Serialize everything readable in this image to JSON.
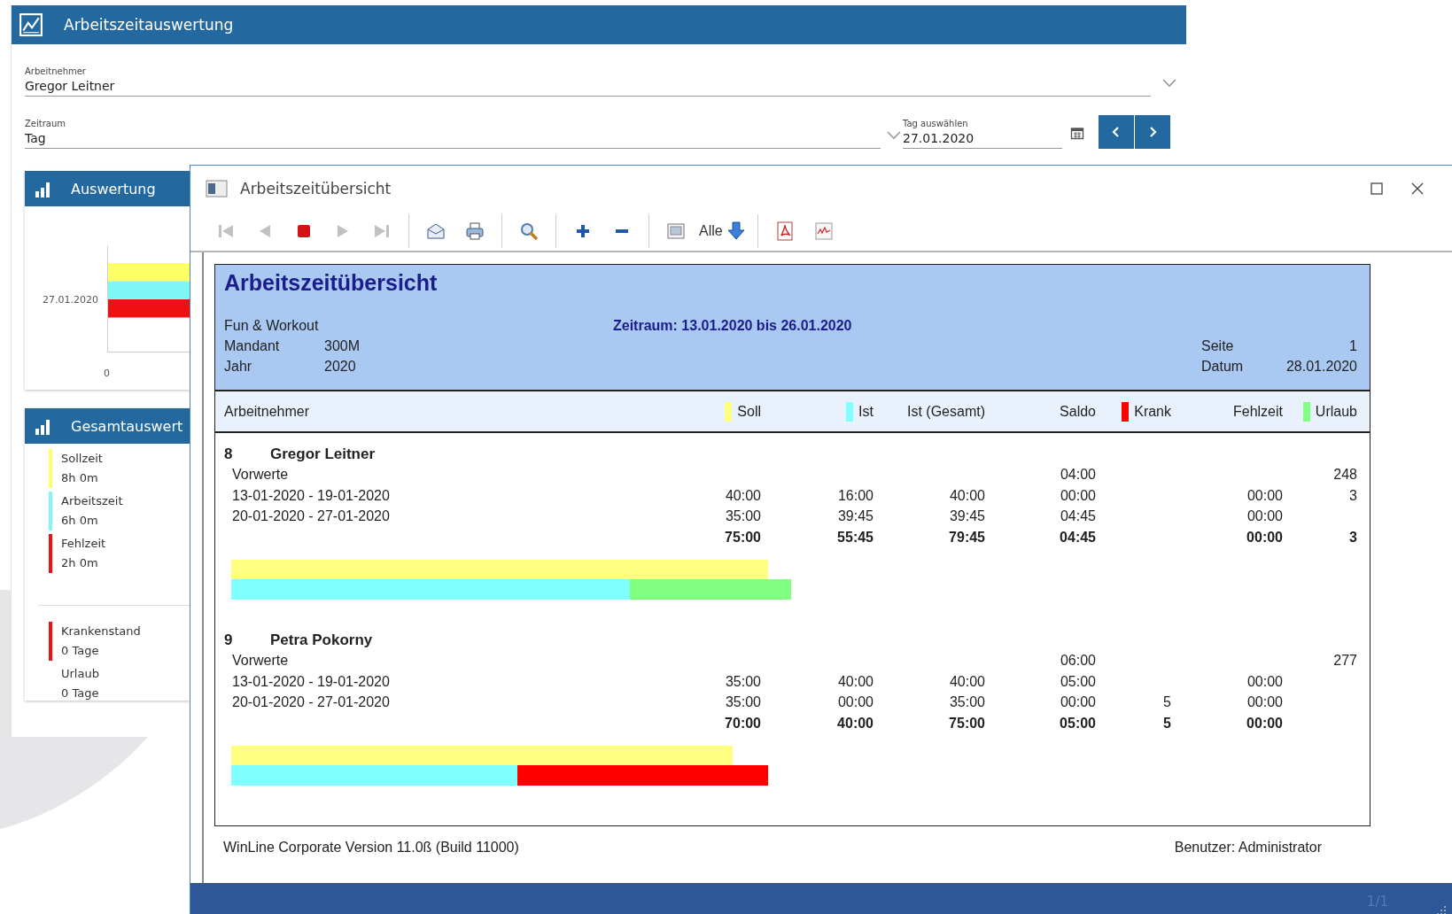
{
  "app": {
    "title": "Arbeitszeitauswertung",
    "employee_field": {
      "label": "Arbeitnehmer",
      "value": "Gregor Leitner"
    },
    "period_field": {
      "label": "Zeitraum",
      "value": "Tag"
    },
    "date_field": {
      "label": "Tag auswählen",
      "value": "27.01.2020"
    }
  },
  "auswertung": {
    "title": "Auswertung",
    "category": "27.01.2020",
    "x_tick": "0"
  },
  "gesamtauswertung": {
    "title": "Gesamtauswert",
    "groups": [
      [
        {
          "label": "Sollzeit",
          "value": "8h 0m",
          "color": "#ffff66"
        },
        {
          "label": "Arbeitszeit",
          "value": "6h 0m",
          "color": "#7ff7f7"
        },
        {
          "label": "Fehlzeit",
          "value": "2h 0m",
          "color": "#ee1111"
        }
      ],
      [
        {
          "label": "Krankenstand",
          "value": "0 Tage",
          "color": "#ee1111"
        },
        {
          "label": "Urlaub",
          "value": "0 Tage"
        }
      ]
    ]
  },
  "report_window": {
    "title": "Arbeitszeitübersicht",
    "toolbar": [
      {
        "kind": "first",
        "disabled": true
      },
      {
        "kind": "prev",
        "disabled": true
      },
      {
        "kind": "stop",
        "disabled": false
      },
      {
        "kind": "next",
        "disabled": true
      },
      {
        "kind": "last",
        "disabled": true
      },
      {
        "kind": "separator"
      },
      {
        "kind": "mail",
        "disabled": false
      },
      {
        "kind": "print",
        "disabled": false
      },
      {
        "kind": "separator"
      },
      {
        "kind": "zoom",
        "disabled": false
      },
      {
        "kind": "separator"
      },
      {
        "kind": "plus",
        "disabled": false
      },
      {
        "kind": "minus",
        "disabled": false
      },
      {
        "kind": "separator"
      },
      {
        "kind": "image",
        "disabled": false
      },
      {
        "kind": "filter",
        "label": "Alle",
        "disabled": false
      },
      {
        "kind": "separator"
      },
      {
        "kind": "pdf",
        "disabled": false
      },
      {
        "kind": "chart",
        "disabled": false
      }
    ],
    "report": {
      "title": "Arbeitszeitübersicht",
      "company": "Fun & Workout",
      "meta": [
        {
          "label": "Mandant",
          "value": "300M"
        },
        {
          "label": "Jahr",
          "value": "2020"
        }
      ],
      "period": "Zeitraum: 13.01.2020 bis 26.01.2020",
      "page_meta": [
        {
          "label": "Seite",
          "value": "1"
        },
        {
          "label": "Datum",
          "value": "28.01.2020"
        }
      ],
      "first_column": "Arbeitnehmer",
      "columns": [
        {
          "label": "Soll",
          "color": "#ffff80"
        },
        {
          "label": "Ist",
          "color": "#80ffff"
        },
        {
          "label": "Ist (Gesamt)"
        },
        {
          "label": "Saldo"
        },
        {
          "label": "Krank",
          "color": "#ff0000"
        },
        {
          "label": "Fehlzeit"
        },
        {
          "label": "Urlaub",
          "color": "#80ff80"
        }
      ],
      "employees": [
        {
          "number": "8",
          "name": "Gregor Leitner",
          "rows": [
            {
              "kind": "normal",
              "label": "Vorwerte",
              "cells": [
                null,
                null,
                null,
                "04:00",
                null,
                null,
                "248"
              ]
            },
            {
              "kind": "normal",
              "label": "13-01-2020 - 19-01-2020",
              "cells": [
                "40:00",
                "16:00",
                "40:00",
                "00:00",
                null,
                "00:00",
                "3"
              ]
            },
            {
              "kind": "normal",
              "label": "20-01-2020 - 27-01-2020",
              "cells": [
                "35:00",
                "39:45",
                "39:45",
                "04:45",
                null,
                "00:00",
                null
              ]
            },
            {
              "kind": "total",
              "cells": [
                "75:00",
                "55:45",
                "79:45",
                "04:45",
                null,
                "00:00",
                "3"
              ]
            }
          ]
        },
        {
          "number": "9",
          "name": "Petra Pokorny",
          "rows": [
            {
              "kind": "normal",
              "label": "Vorwerte",
              "cells": [
                null,
                null,
                null,
                "06:00",
                null,
                null,
                "277"
              ]
            },
            {
              "kind": "normal",
              "label": "13-01-2020 - 19-01-2020",
              "cells": [
                "35:00",
                "40:00",
                "40:00",
                "05:00",
                null,
                "00:00",
                null
              ]
            },
            {
              "kind": "normal",
              "label": "20-01-2020 - 27-01-2020",
              "cells": [
                "35:00",
                "00:00",
                "35:00",
                "00:00",
                "5",
                "00:00",
                null
              ]
            },
            {
              "kind": "total",
              "cells": [
                "70:00",
                "40:00",
                "75:00",
                "05:00",
                "5",
                "00:00",
                null
              ]
            }
          ]
        }
      ]
    },
    "footer_left": "WinLine Corporate Version 11.0ß (Build 11000)",
    "footer_right": "Benutzer: Administrator",
    "status": "1/1"
  }
}
